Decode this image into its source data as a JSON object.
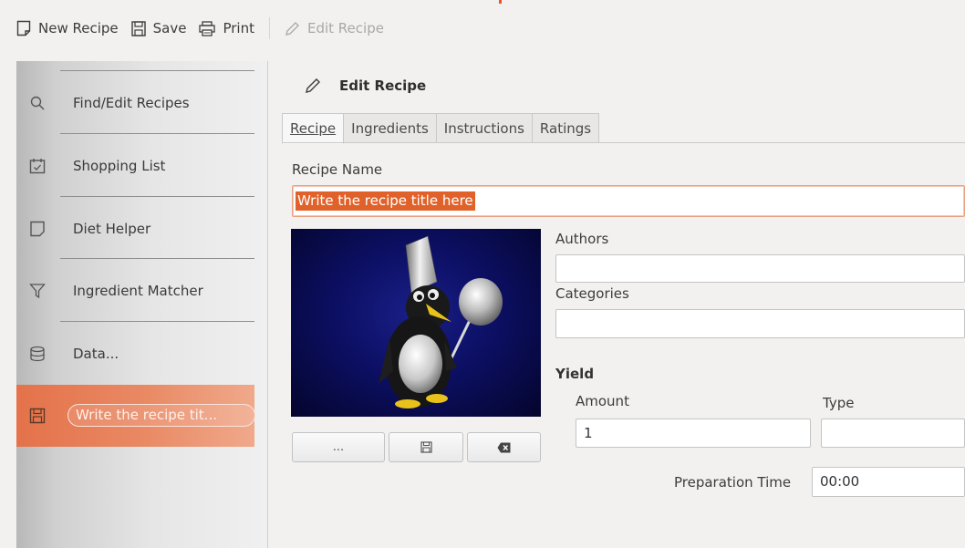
{
  "toolbar": {
    "new_recipe": "New Recipe",
    "save": "Save",
    "print": "Print",
    "edit_recipe": "Edit Recipe"
  },
  "sidebar": {
    "items": [
      {
        "label": "Find/Edit Recipes",
        "icon": "search-icon"
      },
      {
        "label": "Shopping List",
        "icon": "calendar-check-icon"
      },
      {
        "label": "Diet Helper",
        "icon": "note-icon"
      },
      {
        "label": "Ingredient Matcher",
        "icon": "filter-icon"
      },
      {
        "label": "Data...",
        "icon": "database-icon"
      },
      {
        "label": "Write the recipe tit...",
        "icon": "floppy-icon",
        "active": true
      }
    ]
  },
  "editor": {
    "header_title": "Edit Recipe",
    "tabs": [
      "Recipe",
      "Ingredients",
      "Instructions",
      "Ratings"
    ],
    "active_tab": "Recipe",
    "recipe_name_label": "Recipe Name",
    "recipe_name_value": "Write the recipe title here",
    "authors_label": "Authors",
    "authors_value": "",
    "categories_label": "Categories",
    "categories_value": "",
    "image_buttons": [
      "...",
      "save-icon",
      "clear-icon"
    ],
    "yield_label": "Yield",
    "amount_label": "Amount",
    "amount_value": "1",
    "type_label": "Type",
    "type_value": "",
    "prep_time_label": "Preparation Time",
    "prep_time_value": "00:00"
  },
  "colors": {
    "accent": "#e95420",
    "selection": "#e0622a",
    "image_bg": "#0c0f63"
  }
}
